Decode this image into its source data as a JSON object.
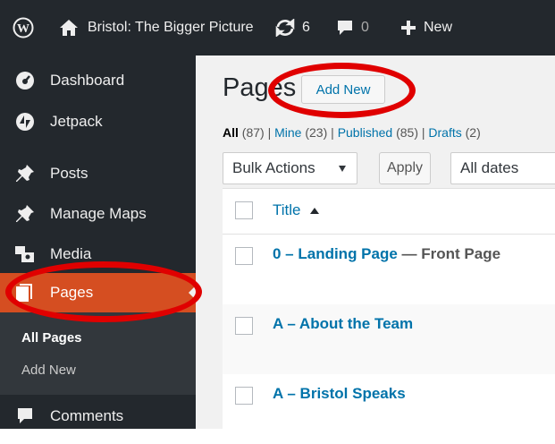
{
  "adminbar": {
    "site_name": "Bristol: The Bigger Picture",
    "updates_count": "6",
    "comments_count": "0",
    "new_label": "New"
  },
  "sidebar": {
    "items": [
      {
        "label": "Dashboard",
        "icon": "dashboard-icon"
      },
      {
        "label": "Jetpack",
        "icon": "jetpack-icon"
      },
      {
        "label": "Posts",
        "icon": "pin-icon"
      },
      {
        "label": "Manage Maps",
        "icon": "pin-icon"
      },
      {
        "label": "Media",
        "icon": "media-icon"
      },
      {
        "label": "Pages",
        "icon": "pages-icon"
      },
      {
        "label": "Comments",
        "icon": "comment-icon"
      }
    ],
    "submenu": [
      "All Pages",
      "Add New"
    ]
  },
  "main": {
    "title": "Pages",
    "add_new": "Add New",
    "filters": {
      "all": "All",
      "all_count": "(87)",
      "mine": "Mine",
      "mine_count": "(23)",
      "published": "Published",
      "published_count": "(85)",
      "drafts": "Drafts",
      "drafts_count": "(2)"
    },
    "bulk_actions": "Bulk Actions",
    "apply": "Apply",
    "dates": "All dates",
    "column_title": "Title",
    "rows": [
      {
        "title": "0 – Landing Page",
        "state": "— Front Page"
      },
      {
        "title": "A – About the Team",
        "state": ""
      },
      {
        "title": "A – Bristol Speaks",
        "state": ""
      }
    ]
  },
  "colors": {
    "adminbar_bg": "#23282d",
    "active_menu": "#d54e21",
    "link": "#0073aa",
    "annotation": "#e00000"
  }
}
